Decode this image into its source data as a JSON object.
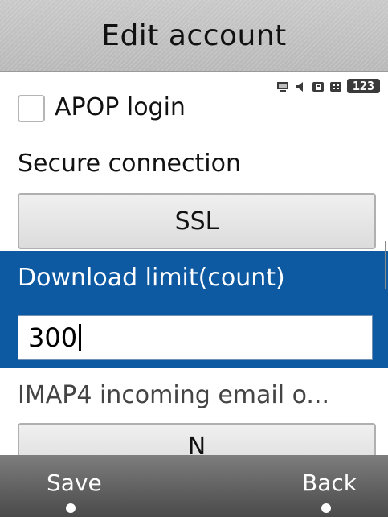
{
  "header": {
    "title": "Edit account"
  },
  "status": {
    "badge": "123",
    "icons": [
      "computer-icon",
      "speaker-icon",
      "r-box-icon",
      "grid-box-icon"
    ]
  },
  "apop": {
    "label": "APOP login",
    "checked": false
  },
  "secure": {
    "label": "Secure connection",
    "value": "SSL"
  },
  "download": {
    "label": "Download limit(count)",
    "value": "300"
  },
  "imap": {
    "label": "IMAP4 incoming email o...",
    "value": "N"
  },
  "softkeys": {
    "left": "Save",
    "right": "Back"
  },
  "colors": {
    "highlight": "#0e5aa2",
    "softkey_bar": "#5c5c5c"
  }
}
